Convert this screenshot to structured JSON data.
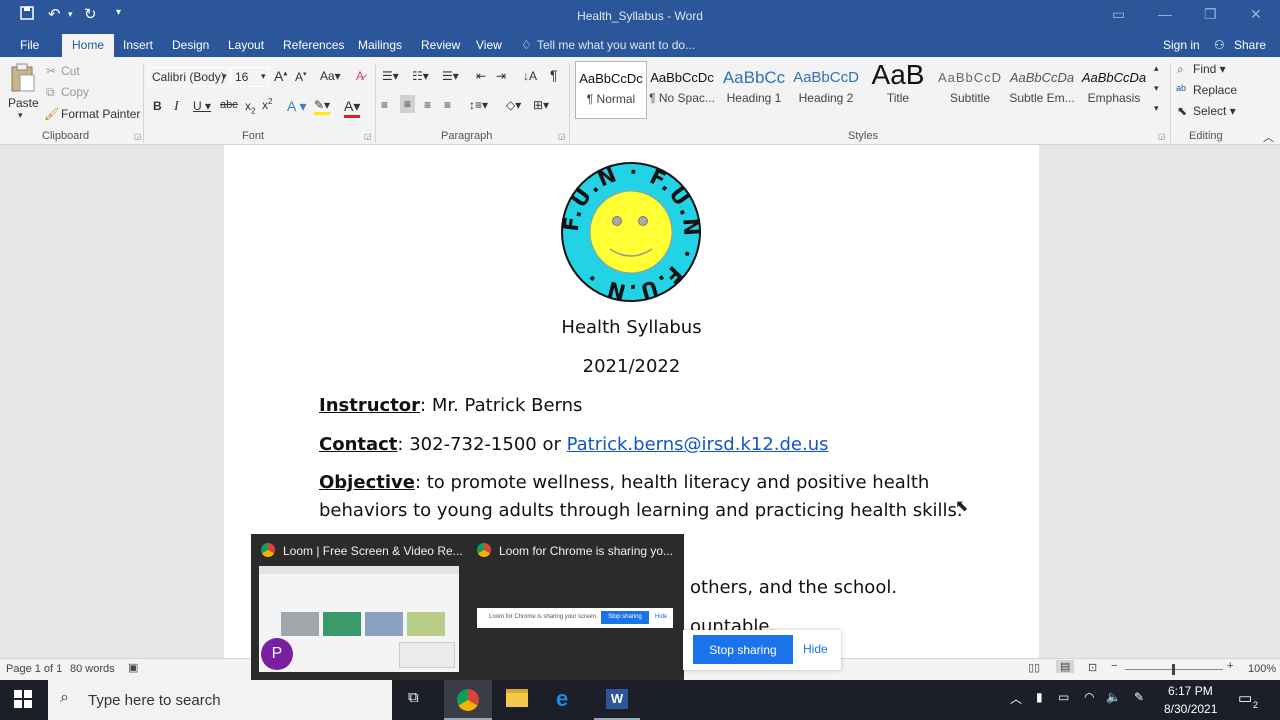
{
  "titlebar": {
    "doc_title": "Health_Syllabus  -  Word"
  },
  "tabs": [
    "File",
    "Home",
    "Insert",
    "Design",
    "Layout",
    "References",
    "Mailings",
    "Review",
    "View"
  ],
  "tell_me": "Tell me what you want to do...",
  "account": {
    "sign_in": "Sign in",
    "share": "Share"
  },
  "clipboard": {
    "paste": "Paste",
    "cut": "Cut",
    "copy": "Copy",
    "format_painter": "Format Painter",
    "label": "Clipboard"
  },
  "font": {
    "name": "Calibri (Body)",
    "size": "16",
    "label": "Font"
  },
  "paragraph": {
    "label": "Paragraph"
  },
  "styles": {
    "label": "Styles",
    "items": [
      {
        "preview": "AaBbCcDc",
        "name": "¶ Normal"
      },
      {
        "preview": "AaBbCcDc",
        "name": "¶ No Spac..."
      },
      {
        "preview": "AaBbCc",
        "name": "Heading 1"
      },
      {
        "preview": "AaBbCcD",
        "name": "Heading 2"
      },
      {
        "preview": "AaB",
        "name": "Title"
      },
      {
        "preview": "AaBbCcD",
        "name": "Subtitle"
      },
      {
        "preview": "AaBbCcDa",
        "name": "Subtle Em..."
      },
      {
        "preview": "AaBbCcDa",
        "name": "Emphasis"
      }
    ]
  },
  "editing": {
    "find": "Find",
    "replace": "Replace",
    "select": "Select",
    "label": "Editing"
  },
  "logo": {
    "text": "F.U.N",
    "colors": {
      "ring": "#22d3e6",
      "face": "#ffff33"
    }
  },
  "document": {
    "title": "Health Syllabus",
    "year": "2021/2022",
    "instructor_label": "Instructor",
    "instructor_value": ":  Mr. Patrick Berns",
    "contact_label": "Contact",
    "contact_value": ":  302-732-1500 or ",
    "contact_email": "Patrick.berns@irsd.k12.de.us",
    "objective_label": "Objective",
    "objective_line1": ":  to promote wellness, health literacy and positive health",
    "objective_line2": "behaviors to young adults through learning and practicing health skills.",
    "partial_line1": "others, and the school.",
    "partial_line2": "ountable."
  },
  "status": {
    "page": "Page 1 of 1",
    "words": "80 words",
    "zoom": "100%"
  },
  "thumbnails": [
    {
      "title": "Loom | Free Screen & Video Re...",
      "avatar": "P"
    },
    {
      "title": "Loom for Chrome is sharing yo..."
    }
  ],
  "loom": {
    "stop_sharing": "Stop sharing",
    "hide": "Hide",
    "mini_text": "Loom for Chrome is sharing your screen."
  },
  "taskbar": {
    "search_placeholder": "Type here to search",
    "time": "6:17 PM",
    "date": "8/30/2021",
    "notifications": "2"
  },
  "colors": {
    "word_blue": "#2b579a",
    "link": "#1155cc",
    "loom_blue": "#1a73e8"
  }
}
